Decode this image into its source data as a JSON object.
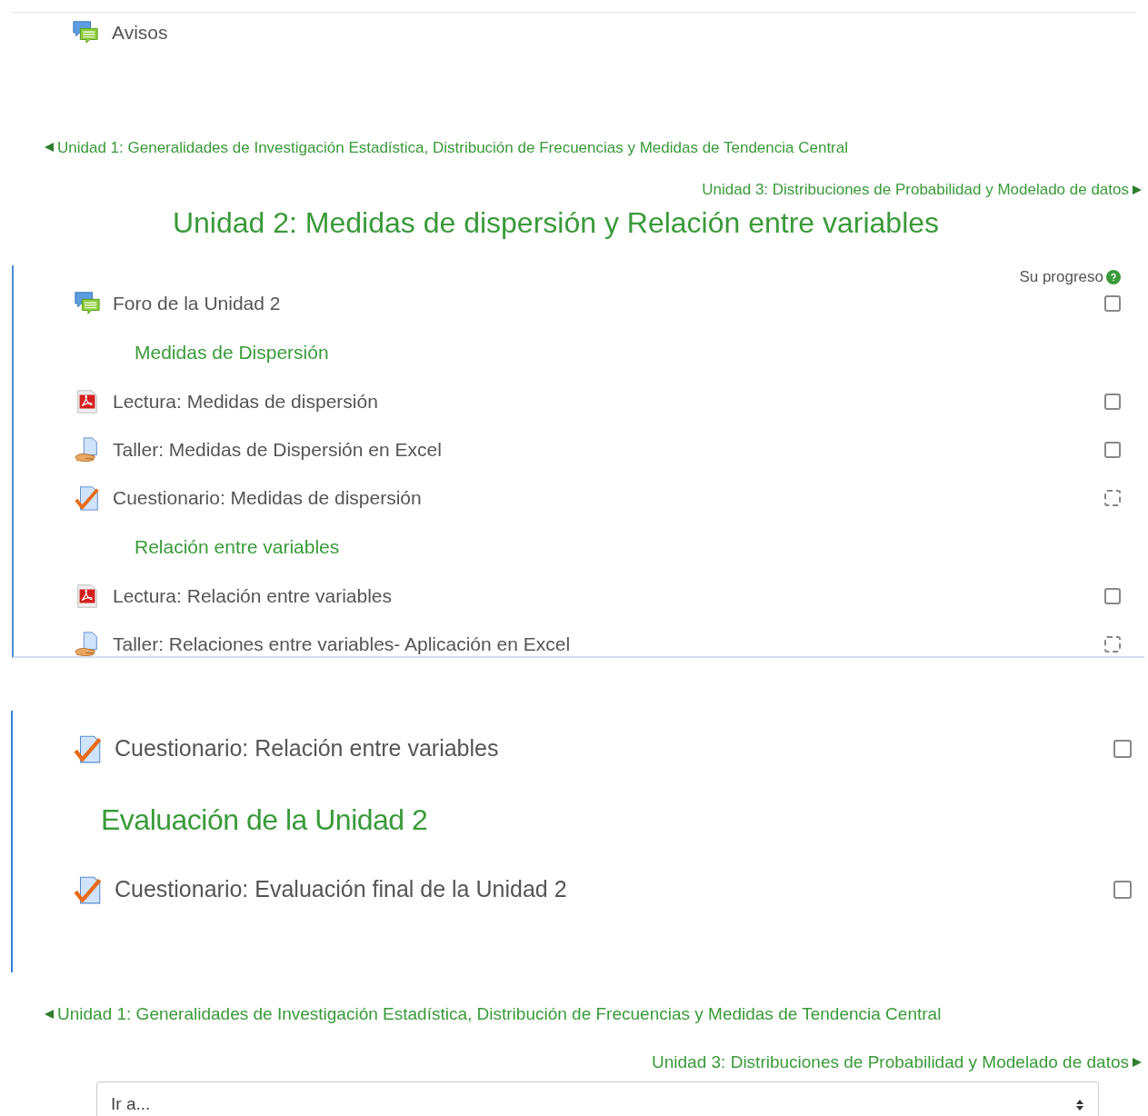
{
  "top_item": {
    "kind": "forum",
    "title": "Avisos"
  },
  "nav_top": {
    "previous": "Unidad 1: Generalidades de Investigación Estadística, Distribución de Frecuencias y Medidas de Tendencia Central",
    "next": "Unidad 3: Distribuciones de Probabilidad y Modelado de datos"
  },
  "section": {
    "title": "Unidad 2: Medidas de dispersión y Relación entre variables",
    "progress_label": "Su progreso",
    "items": [
      {
        "kind": "forum",
        "title": "Foro de la Unidad 2",
        "completion": {
          "kind": "manual",
          "checked": false
        }
      },
      {
        "kind": "label",
        "title": "Medidas de Dispersión"
      },
      {
        "kind": "pdf",
        "title": "Lectura: Medidas de dispersión",
        "completion": {
          "kind": "manual",
          "checked": false
        }
      },
      {
        "kind": "assignment",
        "title": "Taller: Medidas de Dispersión en Excel",
        "completion": {
          "kind": "manual",
          "checked": false
        }
      },
      {
        "kind": "quiz",
        "title": "Cuestionario: Medidas de dispersión",
        "completion": {
          "kind": "automatic",
          "checked": false
        }
      },
      {
        "kind": "label",
        "title": "Relación entre variables"
      },
      {
        "kind": "pdf",
        "title": "Lectura: Relación entre variables",
        "completion": {
          "kind": "manual",
          "checked": false
        }
      },
      {
        "kind": "assignment",
        "title": "Taller: Relaciones entre variables- Aplicación en Excel",
        "completion": {
          "kind": "automatic",
          "checked": false
        }
      }
    ]
  },
  "section_continued": {
    "items": [
      {
        "kind": "quiz",
        "title": "Cuestionario: Relación entre variables",
        "completion": {
          "kind": "manual",
          "checked": false
        }
      },
      {
        "kind": "label",
        "title": "Evaluación de la Unidad 2"
      },
      {
        "kind": "quiz",
        "title": "Cuestionario: Evaluación final de la Unidad 2",
        "completion": {
          "kind": "manual",
          "checked": false
        }
      }
    ]
  },
  "nav_bottom": {
    "previous": "Unidad 1: Generalidades de Investigación Estadística, Distribución de Frecuencias y Medidas de Tendencia Central",
    "next": "Unidad 3: Distribuciones de Probabilidad y Modelado de datos"
  },
  "jump_select": {
    "value": "Ir a..."
  }
}
